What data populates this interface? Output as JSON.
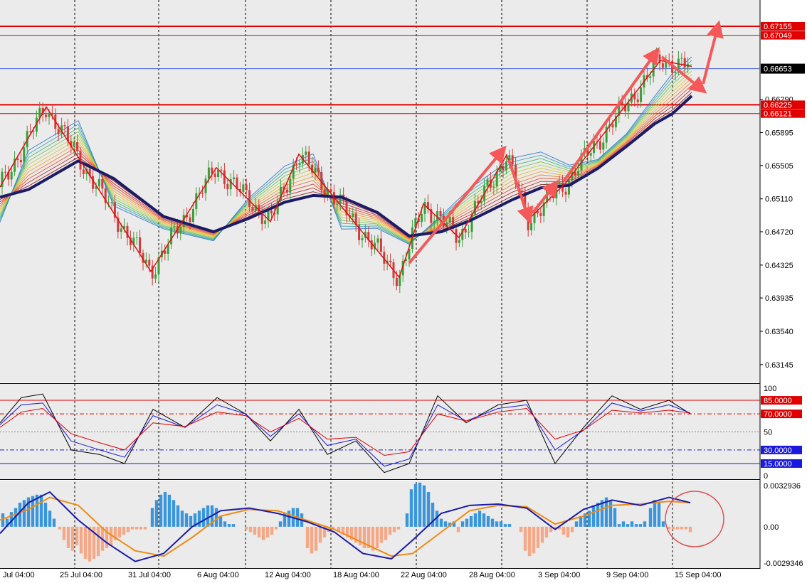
{
  "chart_data": [
    {
      "panel": "main",
      "type": "candlestick",
      "instrument_scale": "price",
      "ylim": [
        0.6295,
        0.6745
      ],
      "price_ticks": [
        {
          "v": 0.6629,
          "label": "0.66290"
        },
        {
          "v": 0.65895,
          "label": "0.65895"
        },
        {
          "v": 0.65505,
          "label": "0.65505"
        },
        {
          "v": 0.6511,
          "label": "0.65110"
        },
        {
          "v": 0.6472,
          "label": "0.64720"
        },
        {
          "v": 0.64325,
          "label": "0.64325"
        },
        {
          "v": 0.63935,
          "label": "0.63935"
        },
        {
          "v": 0.6354,
          "label": "0.63540"
        },
        {
          "v": 0.63145,
          "label": "0.63145"
        }
      ],
      "horizontal_levels": [
        {
          "v": 0.67155,
          "label": "0.67155",
          "color": "#e00000"
        },
        {
          "v": 0.67049,
          "label": "0.67049",
          "color": "#e00000"
        },
        {
          "v": 0.66225,
          "label": "0.66225",
          "color": "#e00000"
        },
        {
          "v": 0.66121,
          "label": "0.66121",
          "color": "#e00000"
        }
      ],
      "current_price": {
        "v": 0.66653,
        "label": "0.66653"
      },
      "x_date_labels": [
        "Jul 04:00",
        "25 Jul 04:00",
        "31 Jul 04:00",
        "6 Aug 04:00",
        "12 Aug 04:00",
        "18 Aug 04:00",
        "22 Aug 04:00",
        "28 Aug 04:00",
        "3 Sep 04:00",
        "9 Sep 04:00",
        "15 Sep 04:00"
      ],
      "zigzag_points": [
        [
          0,
          0.6525
        ],
        [
          65,
          0.662
        ],
        [
          212,
          0.6425
        ],
        [
          304,
          0.6548
        ],
        [
          380,
          0.6484
        ],
        [
          420,
          0.6564
        ],
        [
          561,
          0.6418
        ],
        [
          595,
          0.6505
        ],
        [
          645,
          0.6465
        ],
        [
          712,
          0.6563
        ],
        [
          742,
          0.6486
        ],
        [
          795,
          0.653
        ],
        [
          928,
          0.6675
        ],
        [
          972,
          0.6668
        ]
      ],
      "trend_ma_path": [
        [
          0,
          0.6513
        ],
        [
          40,
          0.6522
        ],
        [
          110,
          0.6556
        ],
        [
          160,
          0.6535
        ],
        [
          230,
          0.649
        ],
        [
          300,
          0.6472
        ],
        [
          350,
          0.6488
        ],
        [
          400,
          0.6507
        ],
        [
          440,
          0.6515
        ],
        [
          480,
          0.6513
        ],
        [
          530,
          0.6495
        ],
        [
          575,
          0.6467
        ],
        [
          620,
          0.6472
        ],
        [
          660,
          0.6485
        ],
        [
          720,
          0.651
        ],
        [
          760,
          0.6524
        ],
        [
          800,
          0.6527
        ],
        [
          840,
          0.6547
        ],
        [
          880,
          0.6573
        ],
        [
          920,
          0.66
        ],
        [
          945,
          0.6612
        ],
        [
          972,
          0.6633
        ]
      ],
      "colors": {
        "bull": "#3a9e3a",
        "bear": "#d43a3a",
        "trend_ma": "#1c1c66",
        "zigzag": "#e01010",
        "arrow": "#f45858",
        "grid": "#b8b8b8",
        "price_line": "#3a5ad8"
      }
    },
    {
      "panel": "stochastic",
      "type": "line",
      "ylim": [
        0,
        100
      ],
      "axis_labels": [
        {
          "v": 100,
          "label": "100"
        },
        {
          "v": 50,
          "label": "50"
        },
        {
          "v": 0,
          "label": "0"
        }
      ],
      "levels": [
        {
          "v": 85,
          "label": "85.0000",
          "color": "#e00000",
          "style": "solid"
        },
        {
          "v": 70,
          "label": "70.0000",
          "color": "#e00000",
          "style": "dash"
        },
        {
          "v": 30,
          "label": "30.0000",
          "color": "#1a1adc",
          "style": "dash"
        },
        {
          "v": 15,
          "label": "15.0000",
          "color": "#1a1adc",
          "style": "solid"
        }
      ],
      "series": [
        {
          "color": "#000000",
          "x": [
            0,
            30,
            60,
            100,
            140,
            175,
            215,
            260,
            305,
            345,
            380,
            420,
            460,
            500,
            540,
            575,
            615,
            655,
            700,
            740,
            780,
            820,
            860,
            900,
            940,
            970
          ],
          "values": [
            60,
            88,
            92,
            30,
            25,
            15,
            75,
            55,
            88,
            70,
            40,
            75,
            25,
            40,
            5,
            15,
            90,
            60,
            80,
            85,
            15,
            55,
            90,
            75,
            85,
            70
          ]
        },
        {
          "color": "#1a1adc",
          "x": [
            0,
            30,
            60,
            100,
            140,
            175,
            215,
            260,
            305,
            345,
            380,
            420,
            460,
            500,
            540,
            575,
            615,
            655,
            700,
            740,
            780,
            820,
            860,
            900,
            940,
            970
          ],
          "values": [
            58,
            80,
            82,
            40,
            30,
            22,
            68,
            55,
            80,
            70,
            45,
            70,
            35,
            42,
            12,
            20,
            80,
            62,
            76,
            80,
            30,
            52,
            82,
            73,
            80,
            71
          ]
        },
        {
          "color": "#e00000",
          "x": [
            0,
            30,
            60,
            100,
            140,
            175,
            215,
            260,
            305,
            345,
            380,
            420,
            460,
            500,
            540,
            575,
            615,
            655,
            700,
            740,
            780,
            820,
            860,
            900,
            940,
            970
          ],
          "values": [
            55,
            72,
            76,
            48,
            38,
            30,
            60,
            56,
            72,
            68,
            50,
            65,
            42,
            44,
            24,
            28,
            70,
            62,
            72,
            76,
            42,
            52,
            74,
            71,
            74,
            71
          ]
        }
      ]
    },
    {
      "panel": "macd",
      "type": "bar",
      "ylim": [
        -0.0029346,
        0.0032936
      ],
      "axis_labels": [
        {
          "v": 0.0032936,
          "label": "0.0032936"
        },
        {
          "v": 0,
          "label": "0.00"
        },
        {
          "v": -0.0029346,
          "label": "-0.0029346"
        }
      ],
      "histogram": [
        [
          4,
          0.001
        ],
        [
          10,
          0.0006
        ],
        [
          16,
          0.0011
        ],
        [
          22,
          0.0014
        ],
        [
          28,
          0.0018
        ],
        [
          34,
          0.002
        ],
        [
          40,
          0.0022
        ],
        [
          46,
          0.0023
        ],
        [
          52,
          0.0024
        ],
        [
          58,
          0.0024
        ],
        [
          64,
          0.0018
        ],
        [
          70,
          0.0012
        ],
        [
          76,
          0.0006
        ],
        [
          84,
          -0.0002
        ],
        [
          90,
          -0.001
        ],
        [
          96,
          -0.0016
        ],
        [
          102,
          -0.0018
        ],
        [
          108,
          -0.0014
        ],
        [
          114,
          -0.002
        ],
        [
          120,
          -0.0024
        ],
        [
          126,
          -0.0026
        ],
        [
          132,
          -0.0024
        ],
        [
          138,
          -0.0022
        ],
        [
          144,
          -0.0018
        ],
        [
          150,
          -0.0016
        ],
        [
          156,
          -0.0014
        ],
        [
          162,
          -0.001
        ],
        [
          168,
          -0.0008
        ],
        [
          174,
          -0.0006
        ],
        [
          180,
          -0.0004
        ],
        [
          186,
          -0.0002
        ],
        [
          192,
          -0.0002
        ],
        [
          198,
          -0.0002
        ],
        [
          204,
          -0.0002
        ],
        [
          214,
          0.0014
        ],
        [
          220,
          0.002
        ],
        [
          226,
          0.0024
        ],
        [
          232,
          0.0026
        ],
        [
          238,
          0.0024
        ],
        [
          244,
          0.002
        ],
        [
          250,
          0.0016
        ],
        [
          256,
          0.0012
        ],
        [
          262,
          0.001
        ],
        [
          268,
          0.0008
        ],
        [
          274,
          0.001
        ],
        [
          280,
          0.0012
        ],
        [
          286,
          0.0014
        ],
        [
          292,
          0.0016
        ],
        [
          298,
          0.0016
        ],
        [
          304,
          0.0014
        ],
        [
          310,
          0.0008
        ],
        [
          316,
          0.0004
        ],
        [
          322,
          0.0002
        ],
        [
          328,
          0.0002
        ],
        [
          346,
          -0.0002
        ],
        [
          352,
          -0.0004
        ],
        [
          358,
          -0.0006
        ],
        [
          364,
          -0.0008
        ],
        [
          370,
          -0.001
        ],
        [
          376,
          -0.0008
        ],
        [
          382,
          -0.0006
        ],
        [
          388,
          -0.0002
        ],
        [
          394,
          0.0004
        ],
        [
          400,
          0.001
        ],
        [
          406,
          0.0012
        ],
        [
          412,
          0.0014
        ],
        [
          418,
          0.0014
        ],
        [
          424,
          0.001
        ],
        [
          432,
          -0.0016
        ],
        [
          438,
          -0.002
        ],
        [
          444,
          -0.0018
        ],
        [
          450,
          -0.0012
        ],
        [
          456,
          -0.0008
        ],
        [
          462,
          -0.0004
        ],
        [
          468,
          -0.0002
        ],
        [
          476,
          -0.0004
        ],
        [
          482,
          -0.0006
        ],
        [
          488,
          -0.0008
        ],
        [
          494,
          -0.001
        ],
        [
          500,
          -0.0012
        ],
        [
          506,
          -0.0014
        ],
        [
          512,
          -0.0016
        ],
        [
          518,
          -0.0016
        ],
        [
          524,
          -0.0018
        ],
        [
          530,
          -0.0016
        ],
        [
          536,
          -0.0012
        ],
        [
          542,
          -0.001
        ],
        [
          548,
          -0.0006
        ],
        [
          554,
          -0.0004
        ],
        [
          560,
          -0.0002
        ],
        [
          572,
          0.001
        ],
        [
          578,
          0.0028
        ],
        [
          584,
          0.0032
        ],
        [
          590,
          0.0033
        ],
        [
          596,
          0.0031
        ],
        [
          602,
          0.0026
        ],
        [
          608,
          0.0018
        ],
        [
          614,
          0.0012
        ],
        [
          620,
          0.0006
        ],
        [
          626,
          0.0004
        ],
        [
          632,
          0.0003
        ],
        [
          638,
          0.0004
        ],
        [
          644,
          -0.0004
        ],
        [
          650,
          0.0004
        ],
        [
          656,
          0.0006
        ],
        [
          662,
          0.0008
        ],
        [
          668,
          0.001
        ],
        [
          674,
          0.0012
        ],
        [
          680,
          0.001
        ],
        [
          686,
          0.0008
        ],
        [
          692,
          0.0006
        ],
        [
          698,
          0.0004
        ],
        [
          704,
          0.0004
        ],
        [
          710,
          0.0002
        ],
        [
          716,
          0.0002
        ],
        [
          732,
          -0.0004
        ],
        [
          738,
          -0.0018
        ],
        [
          744,
          -0.0022
        ],
        [
          750,
          -0.002
        ],
        [
          756,
          -0.0016
        ],
        [
          762,
          -0.0012
        ],
        [
          768,
          -0.0008
        ],
        [
          774,
          -0.0004
        ],
        [
          780,
          -0.0002
        ],
        [
          786,
          -0.0002
        ],
        [
          792,
          -0.0006
        ],
        [
          798,
          -0.0008
        ],
        [
          804,
          -0.0004
        ],
        [
          810,
          0.0004
        ],
        [
          816,
          0.0008
        ],
        [
          822,
          0.001
        ],
        [
          828,
          0.0012
        ],
        [
          834,
          0.0016
        ],
        [
          840,
          0.0018
        ],
        [
          846,
          0.002
        ],
        [
          852,
          0.0022
        ],
        [
          858,
          0.002
        ],
        [
          864,
          0.0014
        ],
        [
          870,
          0.0002
        ],
        [
          876,
          0.0004
        ],
        [
          882,
          0.0002
        ],
        [
          888,
          0.0004
        ],
        [
          894,
          0.0002
        ],
        [
          900,
          0.0002
        ],
        [
          906,
          0.0004
        ],
        [
          914,
          0.0014
        ],
        [
          920,
          0.002
        ],
        [
          926,
          0.0018
        ],
        [
          932,
          0.0004
        ],
        [
          940,
          -0.0002
        ],
        [
          946,
          -0.0002
        ],
        [
          952,
          -0.0002
        ],
        [
          958,
          -0.0002
        ],
        [
          964,
          -0.0002
        ],
        [
          970,
          -0.0004
        ]
      ],
      "signal_line": {
        "color": "#f08a10",
        "x": [
          0,
          40,
          70,
          110,
          150,
          190,
          230,
          270,
          310,
          350,
          390,
          430,
          470,
          510,
          550,
          580,
          620,
          660,
          700,
          740,
          780,
          820,
          860,
          900,
          940,
          970
        ],
        "values": [
          0.0005,
          0.0013,
          0.0022,
          0.0016,
          -0.0004,
          -0.0018,
          -0.0022,
          -0.0008,
          0.0008,
          0.0013,
          0.0012,
          0.0005,
          -0.0002,
          -0.0012,
          -0.0022,
          -0.002,
          -0.0004,
          0.0012,
          0.0016,
          0.0015,
          0.0002,
          0.0008,
          0.0016,
          0.0017,
          0.0019,
          0.0018
        ]
      },
      "macd_line": {
        "color": "#1a1aa8",
        "x": [
          0,
          40,
          70,
          110,
          150,
          190,
          230,
          270,
          310,
          350,
          390,
          430,
          470,
          510,
          550,
          580,
          620,
          660,
          700,
          740,
          780,
          820,
          860,
          900,
          940,
          970
        ],
        "values": [
          -0.0005,
          0.0018,
          0.0026,
          0.0005,
          -0.0012,
          -0.0026,
          -0.002,
          0.0,
          0.0012,
          0.0014,
          0.001,
          0.0004,
          -0.0004,
          -0.002,
          -0.0024,
          -0.001,
          0.001,
          0.0016,
          0.0017,
          0.0014,
          -0.0002,
          0.0013,
          0.002,
          0.0016,
          0.0022,
          0.0018
        ]
      },
      "histogram_colors": {
        "positive": "#3a96dc",
        "negative": "#f4a888"
      },
      "highlight_circle_color": "#e05050"
    }
  ]
}
